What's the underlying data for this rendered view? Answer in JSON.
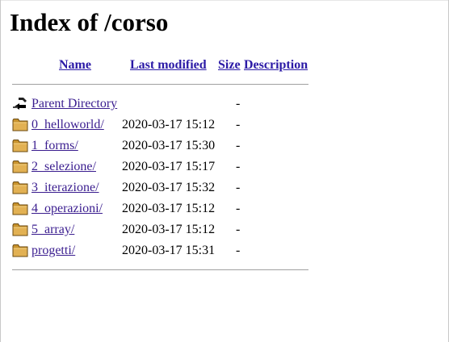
{
  "title": "Index of /corso",
  "columns": {
    "name": "Name",
    "last_modified": "Last modified",
    "size": "Size",
    "description": "Description"
  },
  "parent": {
    "icon": "back-icon",
    "name": "Parent Directory",
    "size": "-"
  },
  "entries": [
    {
      "icon": "folder-icon",
      "name": "0_helloworld/",
      "modified": "2020-03-17 15:12",
      "size": "-"
    },
    {
      "icon": "folder-icon",
      "name": "1_forms/",
      "modified": "2020-03-17 15:30",
      "size": "-"
    },
    {
      "icon": "folder-icon",
      "name": "2_selezione/",
      "modified": "2020-03-17 15:17",
      "size": "-"
    },
    {
      "icon": "folder-icon",
      "name": "3_iterazione/",
      "modified": "2020-03-17 15:32",
      "size": "-"
    },
    {
      "icon": "folder-icon",
      "name": "4_operazioni/",
      "modified": "2020-03-17 15:12",
      "size": "-"
    },
    {
      "icon": "folder-icon",
      "name": "5_array/",
      "modified": "2020-03-17 15:12",
      "size": "-"
    },
    {
      "icon": "folder-icon",
      "name": "progetti/",
      "modified": "2020-03-17 15:31",
      "size": "-"
    }
  ]
}
